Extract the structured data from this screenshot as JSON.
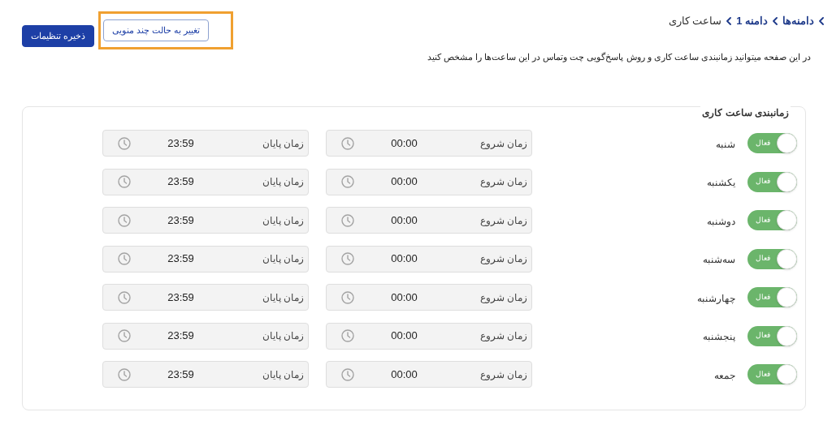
{
  "breadcrumb": [
    {
      "label": "دامنه‌ها",
      "link": true
    },
    {
      "label": "دامنه 1",
      "link": true
    },
    {
      "label": "ساعت کاری",
      "link": false
    }
  ],
  "buttons": [
    {
      "label": "ذخیره تنظیمات",
      "kind": "primary",
      "highlighted": false
    },
    {
      "label": "تغییر به حالت چند منویی",
      "kind": "outline",
      "highlighted": true
    }
  ],
  "description": "در این صفحه میتوانید زمانبندی ساعت کاری و روش پاسخ‌گویی چت وتماس در این ساعت‌ها را مشخص کنید",
  "schedule": {
    "title": "زمانبندی ساعت کاری",
    "days": [
      {
        "day": "شنبه",
        "on": true,
        "toggle_label": "فعال",
        "start_label": "زمان شروع",
        "start": "00:00",
        "end_label": "زمان پایان",
        "end": "23:59"
      },
      {
        "day": "یکشنبه",
        "on": true,
        "toggle_label": "فعال",
        "start_label": "زمان شروع",
        "start": "00:00",
        "end_label": "زمان پایان",
        "end": "23:59"
      },
      {
        "day": "دوشنبه",
        "on": true,
        "toggle_label": "فعال",
        "start_label": "زمان شروع",
        "start": "00:00",
        "end_label": "زمان پایان",
        "end": "23:59"
      },
      {
        "day": "سه‌شنبه",
        "on": true,
        "toggle_label": "فعال",
        "start_label": "زمان شروع",
        "start": "00:00",
        "end_label": "زمان پایان",
        "end": "23:59"
      },
      {
        "day": "چهارشنبه",
        "on": true,
        "toggle_label": "فعال",
        "start_label": "زمان شروع",
        "start": "00:00",
        "end_label": "زمان پایان",
        "end": "23:59"
      },
      {
        "day": "پنجشنبه",
        "on": true,
        "toggle_label": "فعال",
        "start_label": "زمان شروع",
        "start": "00:00",
        "end_label": "زمان پایان",
        "end": "23:59"
      },
      {
        "day": "جمعه",
        "on": true,
        "toggle_label": "فعال",
        "start_label": "زمان شروع",
        "start": "00:00",
        "end_label": "زمان پایان",
        "end": "23:59"
      }
    ]
  }
}
